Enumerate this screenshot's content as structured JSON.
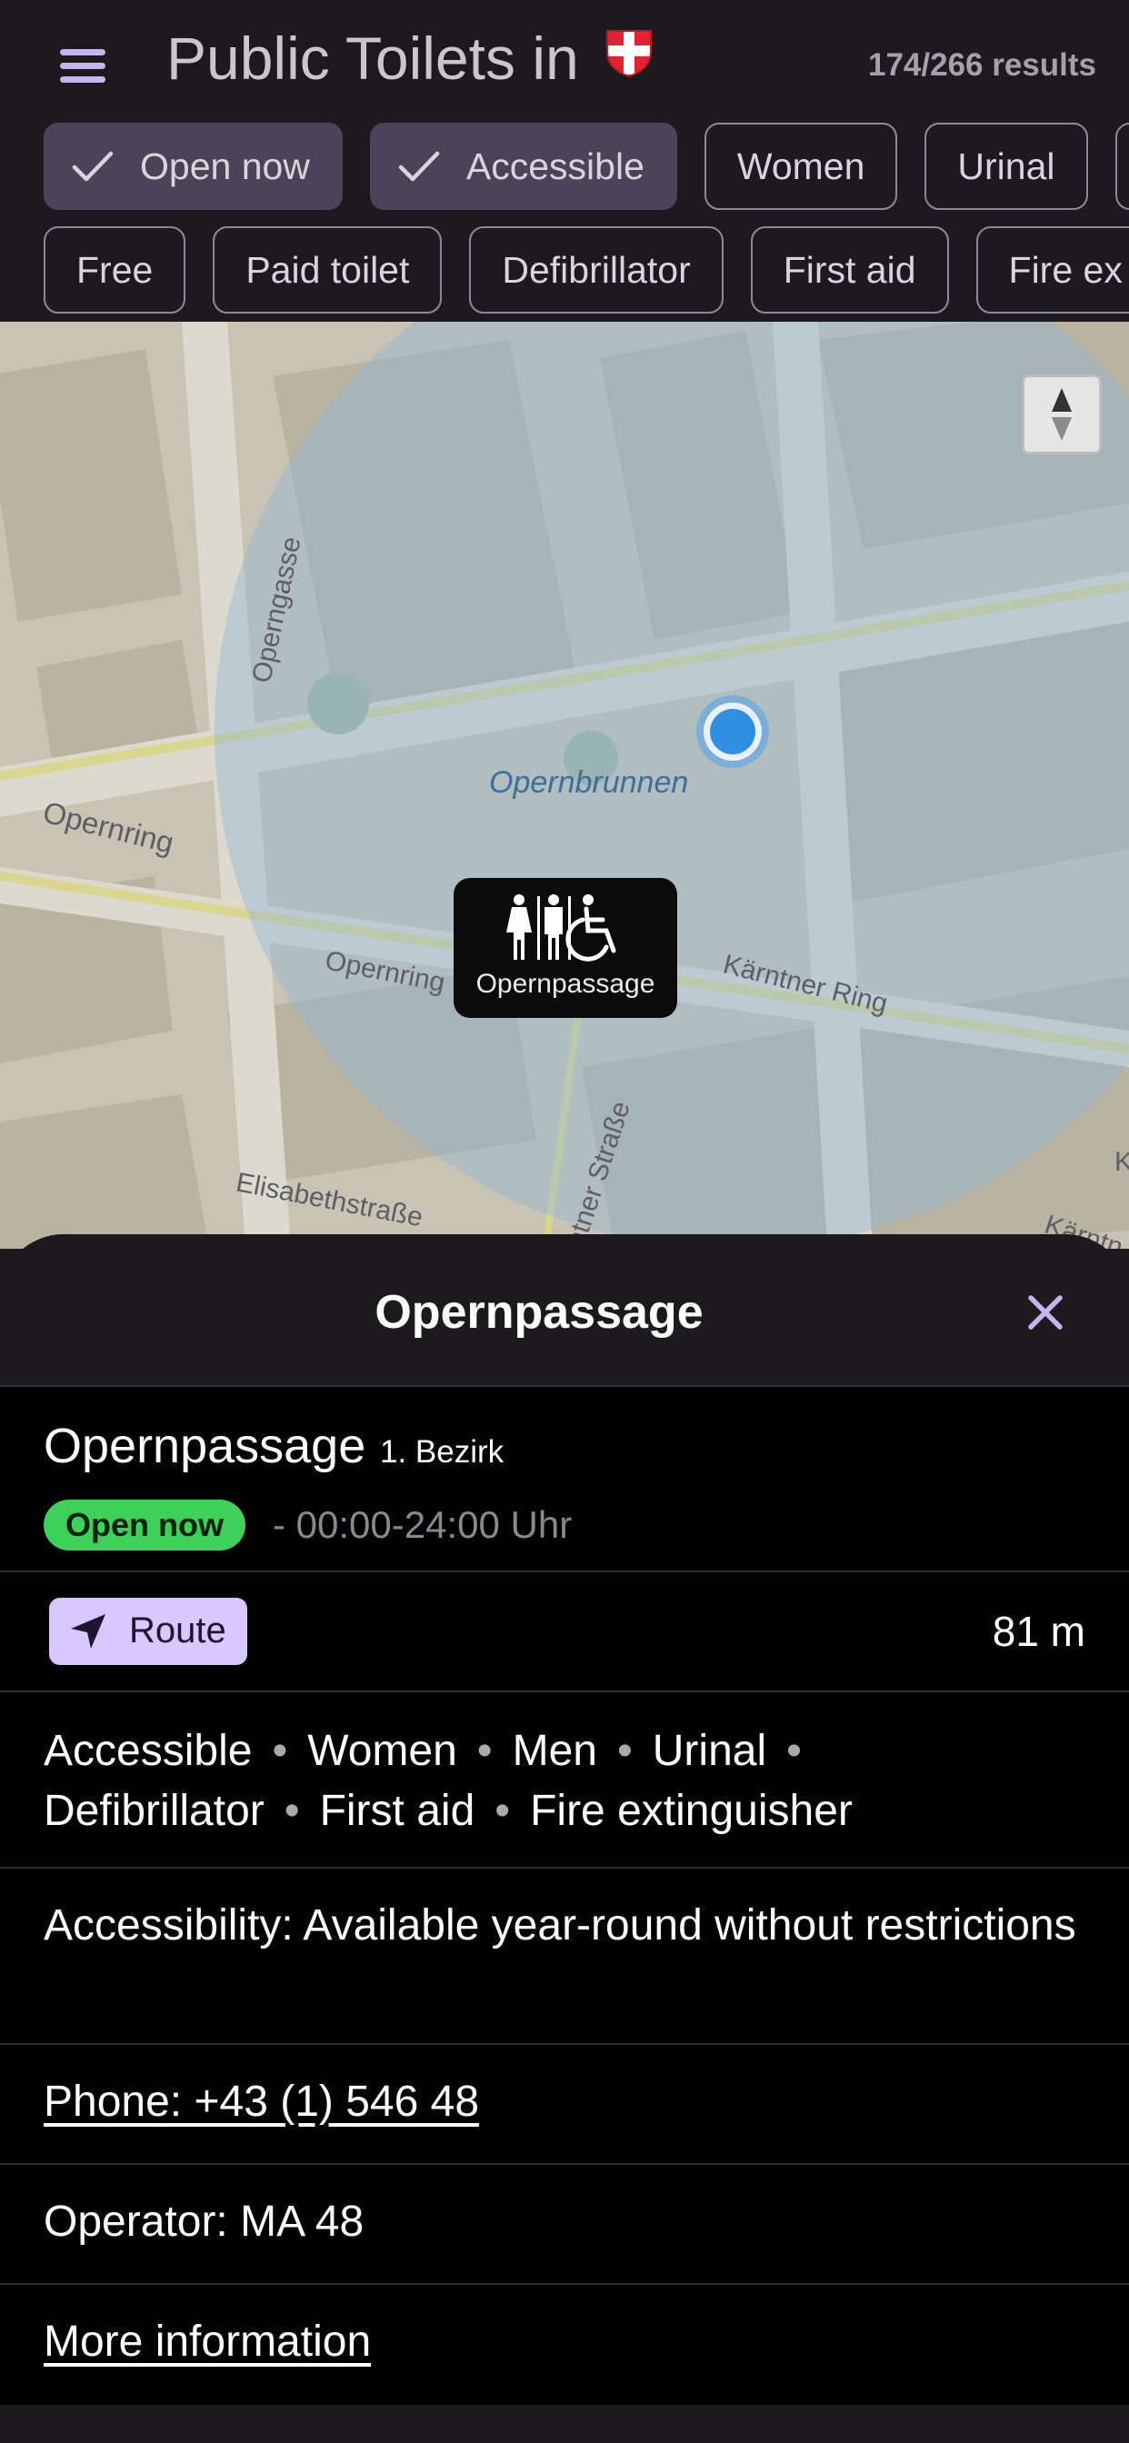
{
  "header": {
    "title": "Public Toilets in",
    "results": "174/266 results",
    "colors": {
      "background": "#1c1a1e",
      "accent": "#c4b5f0",
      "active_chip": "#4a4458"
    }
  },
  "filters": {
    "row1": [
      {
        "label": "Open now",
        "active": true
      },
      {
        "label": "Accessible",
        "active": true
      },
      {
        "label": "Women",
        "active": false
      },
      {
        "label": "Urinal",
        "active": false
      }
    ],
    "row2": [
      {
        "label": "Free",
        "active": false
      },
      {
        "label": "Paid toilet",
        "active": false
      },
      {
        "label": "Defibrillator",
        "active": false
      },
      {
        "label": "First aid",
        "active": false
      },
      {
        "label": "Fire ex",
        "active": false
      }
    ]
  },
  "map": {
    "labels": {
      "operngasse": "Operngasse",
      "opernring_1": "Opernring",
      "opernring_2": "Opernring",
      "opernbrunnen": "Opernbrunnen",
      "kaerntner_ring": "Kärntner Ring",
      "elisabethstrasse": "Elisabethstraße",
      "kaerntner_strasse": "rntner Straße",
      "kaerntner_edge": "Kärntn",
      "k_edge": "K"
    },
    "marker": {
      "label": "Opernpassage",
      "icon": "toilet-accessible-icon"
    },
    "compass_icon": "compass-icon",
    "location_icon": "current-location-icon"
  },
  "sheet": {
    "title": "Opernpassage",
    "name": "Opernpassage",
    "district": "1. Bezirk",
    "status": "Open now",
    "hours": "- 00:00-24:00 Uhr",
    "route_label": "Route",
    "distance": "81 m",
    "features": [
      "Accessible",
      "Women",
      "Men",
      "Urinal",
      "Defibrillator",
      "First aid",
      "Fire extinguisher"
    ],
    "feature_separator": "•",
    "accessibility": "Accessibility: Available year-round without restrictions",
    "phone": "Phone: +43 (1) 546 48",
    "operator": "Operator: MA 48",
    "more_info": "More information",
    "colors": {
      "open_badge": "#3ed15a",
      "route_button": "#d9c8ff",
      "close_icon": "#c4b5f0"
    }
  }
}
